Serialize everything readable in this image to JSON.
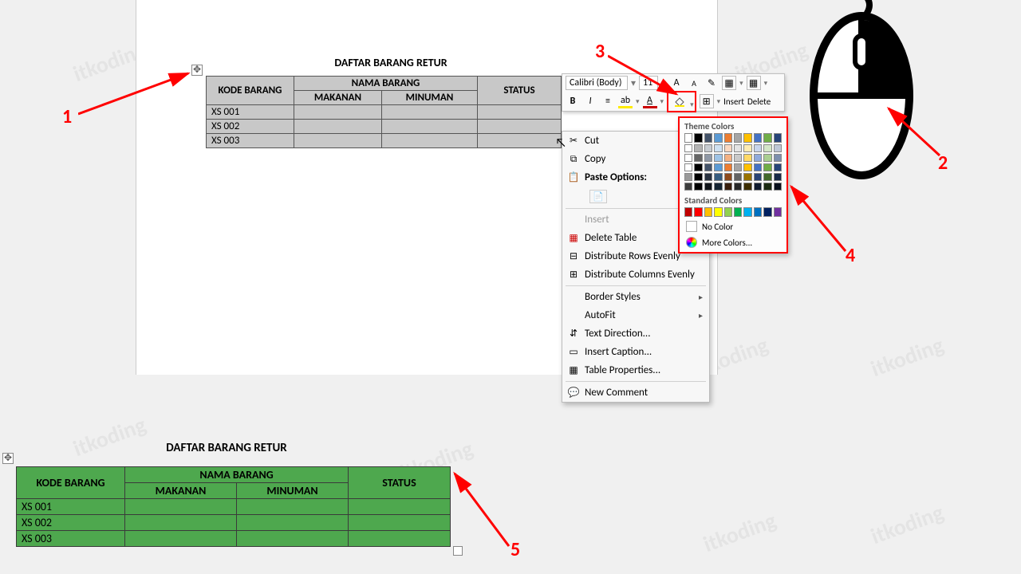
{
  "title1": "DAFTAR BARANG RETUR",
  "title2": "DAFTAR BARANG RETUR",
  "table_headers": {
    "kode": "KODE BARANG",
    "nama": "NAMA BARANG",
    "makanan": "MAKANAN",
    "minuman": "MINUMAN",
    "status": "STATUS"
  },
  "rows": [
    "XS 001",
    "XS 002",
    "XS 003"
  ],
  "mini_toolbar": {
    "font": "Calibri (Body)",
    "size": "11",
    "insert": "Insert",
    "delete": "Delete"
  },
  "ctx": {
    "cut": "Cut",
    "copy": "Copy",
    "paste_options": "Paste Options:",
    "insert": "Insert",
    "delete_table": "Delete Table",
    "dist_rows": "Distribute Rows Evenly",
    "dist_cols": "Distribute Columns Evenly",
    "border_styles": "Border Styles",
    "autofit": "AutoFit",
    "text_dir": "Text Direction...",
    "caption": "Insert Caption...",
    "props": "Table Properties...",
    "comment": "New Comment"
  },
  "color_dd": {
    "theme": "Theme Colors",
    "standard": "Standard Colors",
    "no_color": "No Color",
    "more": "More Colors...",
    "theme_row1": [
      "#ffffff",
      "#000000",
      "#44546a",
      "#5b9bd5",
      "#ed7d31",
      "#a5a5a5",
      "#ffc000",
      "#4472c4",
      "#70ad47",
      "#264478"
    ],
    "standard_row": [
      "#c00000",
      "#ff0000",
      "#ffc000",
      "#ffff00",
      "#92d050",
      "#00b050",
      "#00b0f0",
      "#0070c0",
      "#002060",
      "#7030a0"
    ]
  },
  "annotations": {
    "1": "1",
    "2": "2",
    "3": "3",
    "4": "4",
    "5": "5"
  }
}
